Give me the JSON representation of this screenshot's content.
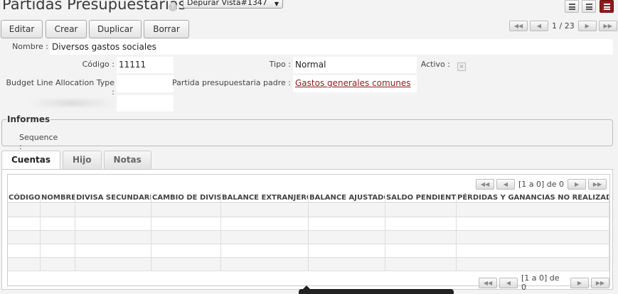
{
  "page": {
    "title": "Partidas Presupuestarias",
    "help": "?",
    "view_select": "Depurar Vista#1347"
  },
  "toolbar": {
    "edit": "Editar",
    "create": "Crear",
    "duplicate": "Duplicar",
    "delete": "Borrar"
  },
  "pager_top": {
    "text": "1 / 23",
    "first": "◀◀",
    "prev": "◀",
    "next": "▶",
    "last": "▶▶"
  },
  "form": {
    "name_label": "Nombre :",
    "name_value": "Diversos gastos sociales",
    "code_label": "Código :",
    "code_value": "11111",
    "type_label": "Tipo :",
    "type_value": "Normal",
    "active_label": "Activo :",
    "active_value": "×",
    "alloc_label": "Budget Line Allocation Type :",
    "alloc_value": "",
    "parent_label": "Partida presupuestaria padre :",
    "parent_value": "Gastos generales comunes"
  },
  "informes": {
    "legend": "Informes",
    "sequence_label": "Sequence :"
  },
  "tabs": [
    {
      "label": "Cuentas"
    },
    {
      "label": "Hijo"
    },
    {
      "label": "Notas"
    }
  ],
  "grid": {
    "pager_text": "[1 a 0] de 0",
    "columns": [
      "CÓDIGO",
      "NOMBRE",
      "DIVISA SECUNDARIA",
      "CAMBIO DE DIVISA",
      "BALANCE EXTRANJERO",
      "BALANCE AJUSTADO",
      "SALDO PENDIENTE",
      "PÉRDIDAS Y GANANCIAS NO REALIZADAS"
    ],
    "empty_rows": 5
  },
  "colors": {
    "accent": "#8b1d1d",
    "background": "#f3f3f3"
  }
}
